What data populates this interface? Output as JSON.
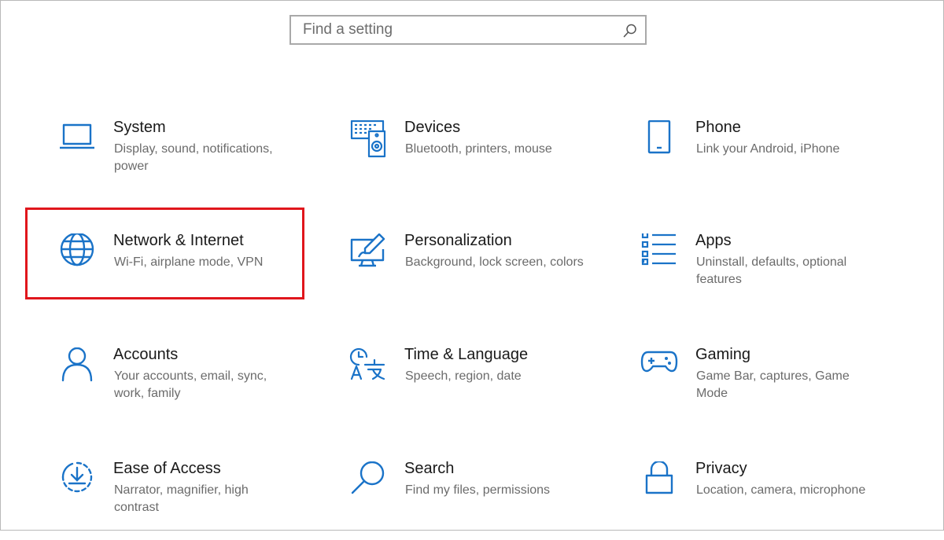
{
  "search": {
    "placeholder": "Find a setting",
    "icon": "search-icon"
  },
  "accent_color": "#1a73c8",
  "highlight_color": "#e0161c",
  "categories": [
    {
      "title": "System",
      "desc": "Display, sound, notifications, power",
      "icon": "laptop-icon"
    },
    {
      "title": "Devices",
      "desc": "Bluetooth, printers, mouse",
      "icon": "keyboard-speaker-icon"
    },
    {
      "title": "Phone",
      "desc": "Link your Android, iPhone",
      "icon": "phone-icon"
    },
    {
      "title": "Network & Internet",
      "desc": "Wi-Fi, airplane mode, VPN",
      "icon": "globe-icon"
    },
    {
      "title": "Personalization",
      "desc": "Background, lock screen, colors",
      "icon": "paint-screen-icon"
    },
    {
      "title": "Apps",
      "desc": "Uninstall, defaults, optional features",
      "icon": "apps-list-icon"
    },
    {
      "title": "Accounts",
      "desc": "Your accounts, email, sync, work, family",
      "icon": "person-icon"
    },
    {
      "title": "Time & Language",
      "desc": "Speech, region, date",
      "icon": "time-language-icon"
    },
    {
      "title": "Gaming",
      "desc": "Game Bar, captures, Game Mode",
      "icon": "gamepad-icon"
    },
    {
      "title": "Ease of Access",
      "desc": "Narrator, magnifier, high contrast",
      "icon": "ease-of-access-icon"
    },
    {
      "title": "Search",
      "desc": "Find my files, permissions",
      "icon": "magnifier-icon"
    },
    {
      "title": "Privacy",
      "desc": "Location, camera, microphone",
      "icon": "lock-icon"
    }
  ],
  "highlighted_item": "Network & Internet"
}
